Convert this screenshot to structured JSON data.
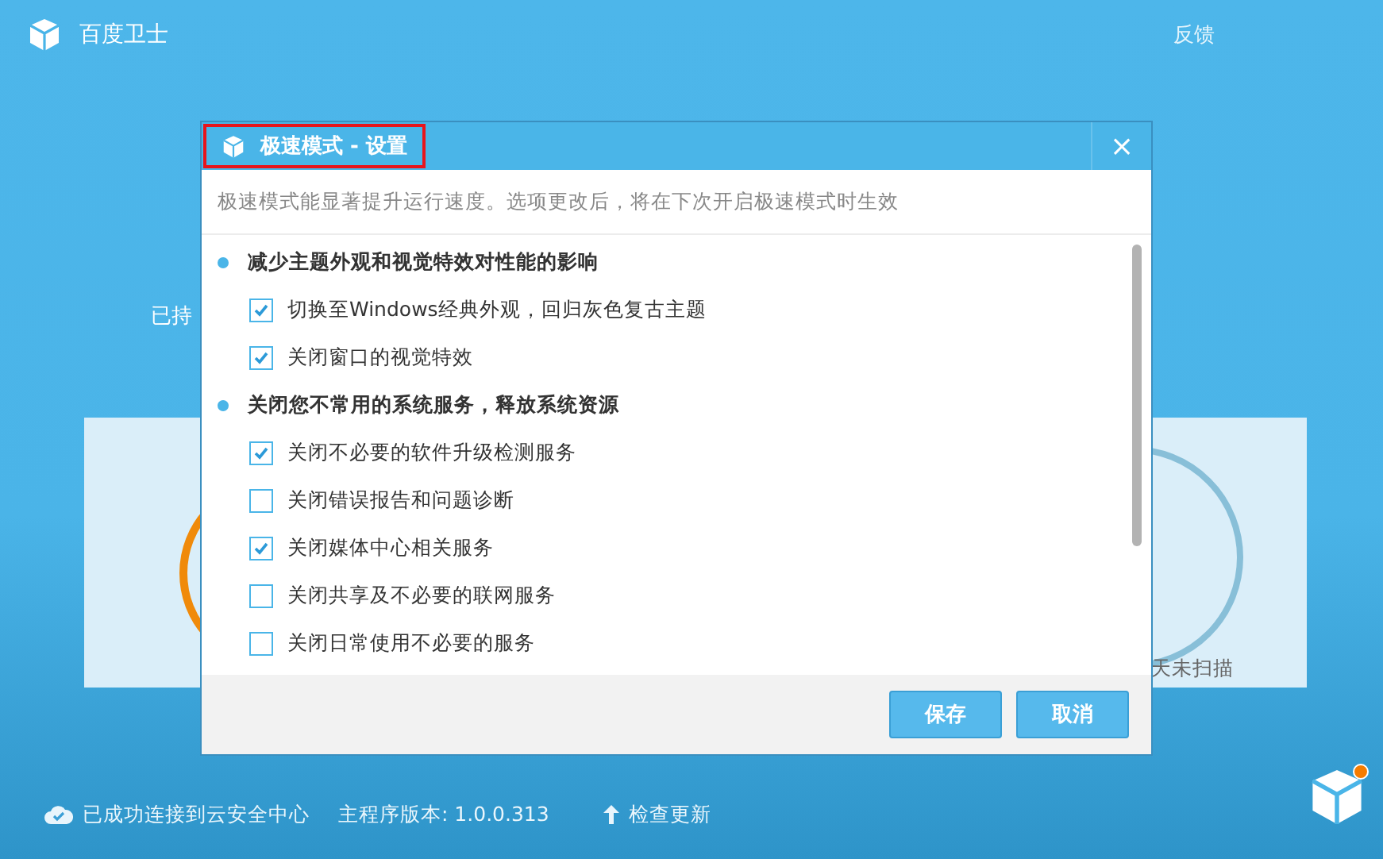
{
  "app": {
    "title": "百度卫士",
    "feedback": "反馈",
    "hero_subtitle": "已持",
    "scan_status": "天未扫描"
  },
  "dialog": {
    "title": "极速模式 - 设置",
    "close": "×",
    "description": "极速模式能显著提升运行速度。选项更改后，将在下次开启极速模式时生效",
    "sections": [
      {
        "heading": "减少主题外观和视觉特效对性能的影响",
        "options": [
          {
            "label": "切换至Windows经典外观，回归灰色复古主题",
            "checked": true
          },
          {
            "label": "关闭窗口的视觉特效",
            "checked": true
          }
        ]
      },
      {
        "heading": "关闭您不常用的系统服务，释放系统资源",
        "options": [
          {
            "label": "关闭不必要的软件升级检测服务",
            "checked": true
          },
          {
            "label": "关闭错误报告和问题诊断",
            "checked": false
          },
          {
            "label": "关闭媒体中心相关服务",
            "checked": true
          },
          {
            "label": "关闭共享及不必要的联网服务",
            "checked": false
          },
          {
            "label": "关闭日常使用不必要的服务",
            "checked": false
          }
        ]
      }
    ],
    "buttons": [
      {
        "label": "保存"
      },
      {
        "label": "取消"
      }
    ]
  },
  "status_bar": {
    "connection": "已成功连接到云安全中心",
    "version": "主程序版本: 1.0.0.313",
    "update": "检查更新"
  }
}
